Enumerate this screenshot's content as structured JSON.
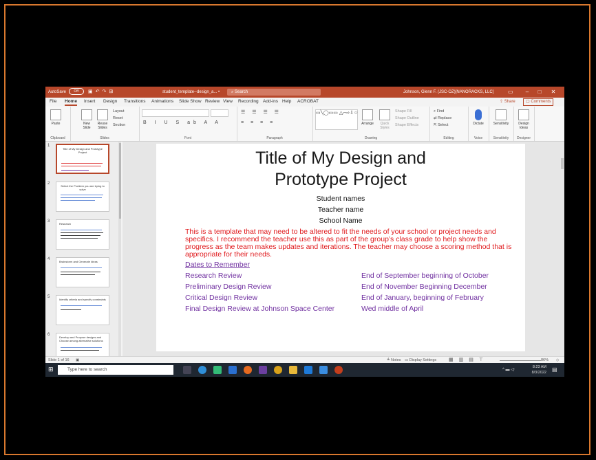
{
  "titlebar": {
    "autosave_label": "AutoSave",
    "autosave_state": "Off",
    "doc_title": "student_template--design_a... •",
    "search_placeholder": "Search",
    "account": "Johnson, Glenn F. (JSC-OZ)[NANORACKS, LLC]"
  },
  "tabs": [
    "File",
    "Home",
    "Insert",
    "Design",
    "Transitions",
    "Animations",
    "Slide Show",
    "Review",
    "View",
    "Recording",
    "Add-ins",
    "Help",
    "ACROBAT"
  ],
  "active_tab": "Home",
  "share_label": "Share",
  "comments_label": "Comments",
  "ribbon": {
    "clipboard": {
      "label": "Clipboard",
      "paste": "Paste"
    },
    "slides": {
      "label": "Slides",
      "new": "New Slide",
      "reuse": "Reuse Slides",
      "layout": "Layout",
      "reset": "Reset",
      "section": "Section"
    },
    "font": {
      "label": "Font"
    },
    "paragraph": {
      "label": "Paragraph"
    },
    "drawing": {
      "label": "Drawing",
      "arrange": "Arrange",
      "quick_styles": "Quick Styles",
      "shape_fill": "Shape Fill",
      "shape_outline": "Shape Outline",
      "shape_effects": "Shape Effects"
    },
    "editing": {
      "label": "Editing",
      "find": "Find",
      "replace": "Replace",
      "select": "Select"
    },
    "voice": {
      "label": "Voice",
      "dictate": "Dictate"
    },
    "sensitivity": {
      "label": "Sensitivity",
      "btn": "Sensitivity"
    },
    "designer": {
      "label": "Designer",
      "btn": "Design Ideas"
    }
  },
  "thumbnails": [
    {
      "num": "1",
      "title": "Title of My Design and Prototype Project"
    },
    {
      "num": "2",
      "title": "Select the Problem you are trying to solve"
    },
    {
      "num": "3",
      "title": "Research"
    },
    {
      "num": "4",
      "title": "Brainstorm and Generate Ideas"
    },
    {
      "num": "5",
      "title": "Identify criteria and specify constraints"
    },
    {
      "num": "6",
      "title": "Develop and Propose designs and Choose among alternative solutions"
    }
  ],
  "slide": {
    "title_line1": "Title of My Design and",
    "title_line2": "Prototype Project",
    "student": "Student names",
    "teacher": "Teacher name",
    "school": "School Name",
    "note": "This is a template that may need to be altered to fit the needs of your school or project needs and specifics.  I recommend the teacher use this as part of the group’s class grade to help show the progress as the team makes updates and iterations. The teacher may choose a scoring method that is appropriate for their needs.",
    "dates_heading": "Dates to Remember",
    "reviews": [
      {
        "name": "Research Review",
        "when": "End of September beginning of October"
      },
      {
        "name": "Preliminary Design Review",
        "when": "End of November Beginning December"
      },
      {
        "name": "Critical Design Review",
        "when": "End of January, beginning of February"
      },
      {
        "name": "Final Design Review at Johnson Space Center",
        "when": "Wed  middle of April"
      }
    ]
  },
  "status": {
    "slide_count": "Slide 1 of 16",
    "notes": "Notes",
    "display_settings": "Display Settings",
    "zoom": "86%"
  },
  "taskbar": {
    "search_placeholder": "Type here to search",
    "time": "8:23 AM",
    "date": "8/3/2022"
  }
}
